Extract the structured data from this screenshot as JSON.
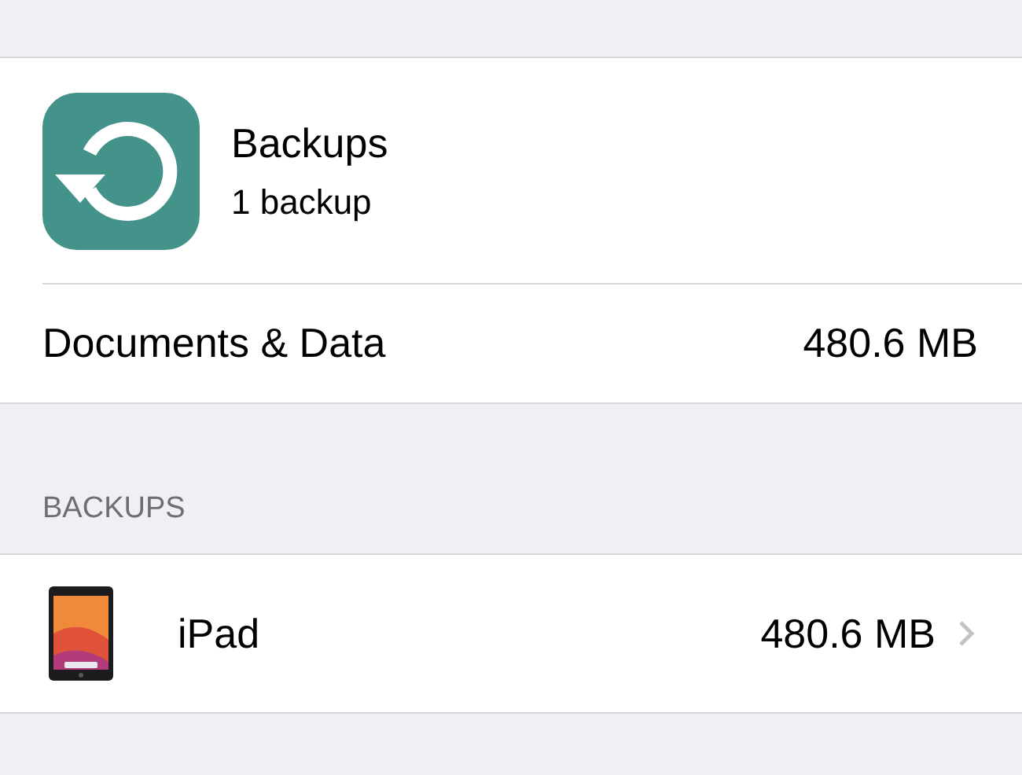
{
  "app": {
    "name": "Backups",
    "subtitle": "1 backup"
  },
  "summary": {
    "label": "Documents & Data",
    "value": "480.6 MB"
  },
  "section_header": "BACKUPS",
  "backups": [
    {
      "name": "iPad",
      "size": "480.6 MB"
    }
  ]
}
